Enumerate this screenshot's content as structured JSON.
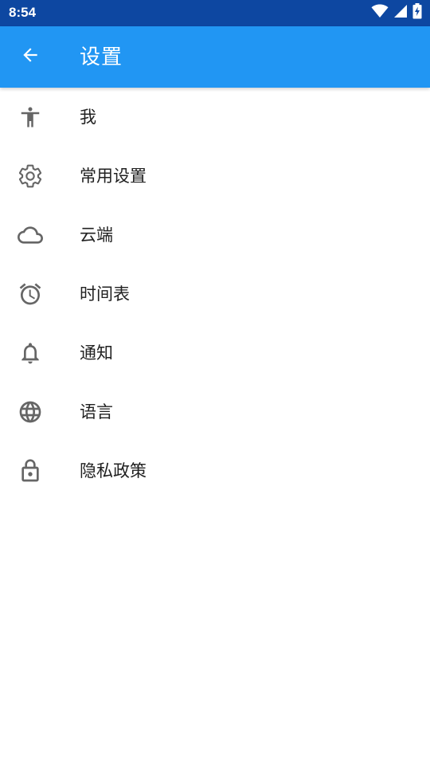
{
  "status_bar": {
    "time": "8:54",
    "icons": [
      "wifi-icon",
      "cellular-signal-icon",
      "battery-charging-icon"
    ]
  },
  "app_bar": {
    "back_icon": "arrow-back-icon",
    "title": "设置"
  },
  "colors": {
    "status_bar": "#0d47a1",
    "app_bar": "#2196f3",
    "icon": "#666666",
    "text": "#212121"
  },
  "menu": {
    "items": [
      {
        "icon": "accessibility-person-icon",
        "label": "我"
      },
      {
        "icon": "gear-icon",
        "label": "常用设置"
      },
      {
        "icon": "cloud-icon",
        "label": "云端"
      },
      {
        "icon": "alarm-clock-icon",
        "label": "时间表"
      },
      {
        "icon": "bell-icon",
        "label": "通知"
      },
      {
        "icon": "globe-icon",
        "label": "语言"
      },
      {
        "icon": "lock-icon",
        "label": "隐私政策"
      }
    ]
  }
}
